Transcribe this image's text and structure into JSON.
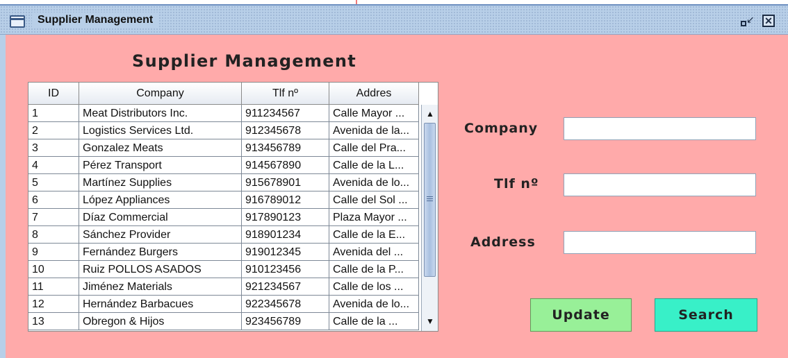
{
  "window": {
    "title": "Supplier Management"
  },
  "heading": "Supplier Management",
  "table": {
    "columns": [
      "ID",
      "Company",
      "Tlf nº",
      "Addres"
    ],
    "rows": [
      [
        "1",
        "Meat Distributors Inc.",
        "911234567",
        "Calle Mayor ..."
      ],
      [
        "2",
        "Logistics Services Ltd.",
        "912345678",
        "Avenida de la..."
      ],
      [
        "3",
        "Gonzalez Meats",
        "913456789",
        "Calle del Pra..."
      ],
      [
        "4",
        "Pérez Transport",
        "914567890",
        "Calle de la L..."
      ],
      [
        "5",
        "Martínez Supplies",
        "915678901",
        "Avenida de lo..."
      ],
      [
        "6",
        "López Appliances",
        "916789012",
        "Calle del Sol ..."
      ],
      [
        "7",
        "Díaz Commercial",
        "917890123",
        "Plaza Mayor ..."
      ],
      [
        "8",
        "Sánchez Provider",
        "918901234",
        "Calle de la E..."
      ],
      [
        "9",
        "Fernández Burgers",
        "919012345",
        "Avenida del ..."
      ],
      [
        "10",
        "Ruiz POLLOS ASADOS",
        "910123456",
        "Calle de la P..."
      ],
      [
        "11",
        "Jiménez Materials",
        "921234567",
        "Calle de los ..."
      ],
      [
        "12",
        "Hernández Barbacues",
        "922345678",
        "Avenida de lo..."
      ],
      [
        "13",
        "Obregon & Hijos",
        "923456789",
        "Calle de la ..."
      ]
    ]
  },
  "form": {
    "company_label": "Company",
    "phone_label": "Tlf nº",
    "address_label": "Address",
    "company_value": "",
    "phone_value": "",
    "address_value": ""
  },
  "buttons": {
    "update": "Update",
    "search": "Search"
  },
  "icons": {
    "window": "window-icon",
    "minimize": "restore-icon",
    "close": "close-icon",
    "scroll_up": "arrow-up-icon",
    "scroll_down": "arrow-down-icon"
  },
  "colors": {
    "background": "#ffaaaa",
    "update_button": "#98f098",
    "search_button": "#38f0c8",
    "titlebar": "#b8cfe8"
  }
}
